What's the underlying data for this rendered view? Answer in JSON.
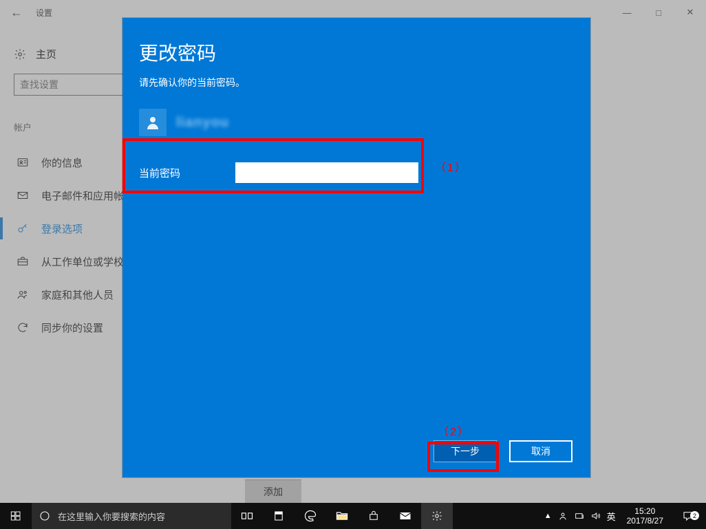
{
  "window": {
    "title": "设置"
  },
  "home_label": "主页",
  "search_placeholder": "查找设置",
  "section_label": "帐户",
  "nav": [
    {
      "label": "你的信息"
    },
    {
      "label": "电子邮件和应用帐户"
    },
    {
      "label": "登录选项"
    },
    {
      "label": "从工作单位或学校访问"
    },
    {
      "label": "家庭和其他人员"
    },
    {
      "label": "同步你的设置"
    }
  ],
  "add_button": "添加",
  "dialog": {
    "title": "更改密码",
    "subtitle": "请先确认你的当前密码。",
    "username": "lianyou",
    "field_label": "当前密码",
    "password_value": "",
    "next": "下一步",
    "cancel": "取消"
  },
  "annotations": {
    "a1": "（1）",
    "a2": "（2）"
  },
  "taskbar": {
    "cortana_placeholder": "在这里输入你要搜索的内容",
    "ime": "英",
    "time": "15:20",
    "date": "2017/8/27",
    "notif_count": "2"
  }
}
